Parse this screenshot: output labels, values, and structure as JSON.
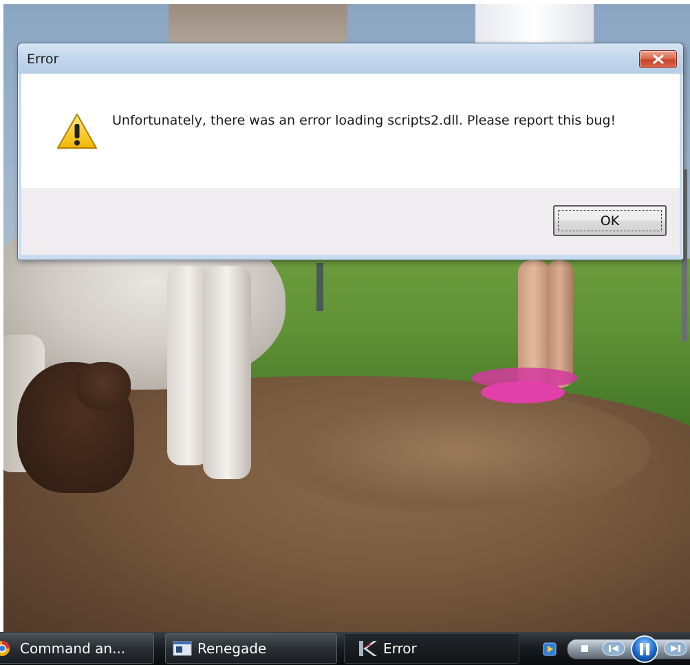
{
  "dialog": {
    "title": "Error",
    "message": "Unfortunately, there was an error loading scripts2.dll. Please report this bug!",
    "ok_label": "OK",
    "icons": {
      "warning": "warning-icon",
      "close": "close-icon"
    }
  },
  "taskbar": {
    "items": [
      {
        "label": "Command an...",
        "icon": "chrome-icon"
      },
      {
        "label": "Renegade",
        "icon": "window-app-icon"
      },
      {
        "label": "Error",
        "icon": "renegade-icon"
      }
    ],
    "media_controls": [
      "media-player-icon",
      "stop-icon",
      "previous-icon",
      "pause-icon",
      "next-icon"
    ]
  },
  "colors": {
    "title_gradient": "#c3d7ec",
    "close_button": "#c7452a",
    "taskbar": "#1a1d20"
  }
}
